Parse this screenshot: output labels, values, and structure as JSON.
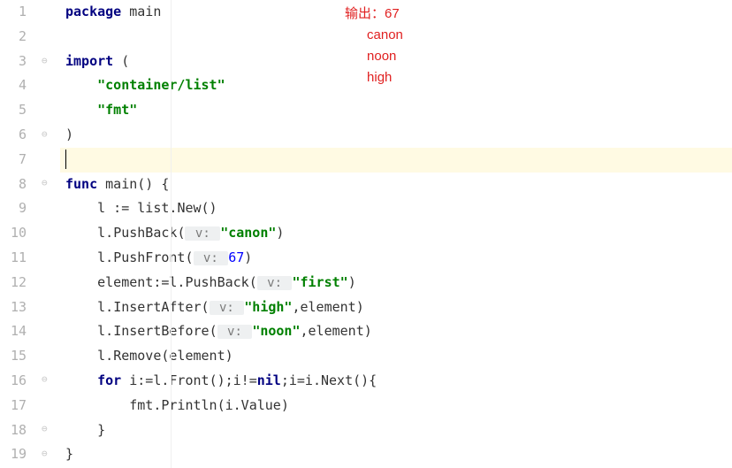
{
  "lines": [
    {
      "n": "1"
    },
    {
      "n": "2"
    },
    {
      "n": "3"
    },
    {
      "n": "4"
    },
    {
      "n": "5"
    },
    {
      "n": "6"
    },
    {
      "n": "7"
    },
    {
      "n": "8"
    },
    {
      "n": "9"
    },
    {
      "n": "10"
    },
    {
      "n": "11"
    },
    {
      "n": "12"
    },
    {
      "n": "13"
    },
    {
      "n": "14"
    },
    {
      "n": "15"
    },
    {
      "n": "16"
    },
    {
      "n": "17"
    },
    {
      "n": "18"
    },
    {
      "n": "19"
    }
  ],
  "code": {
    "l1": {
      "kw1": "package",
      "kw2": "main"
    },
    "l3": {
      "kw": "import",
      "p": " ("
    },
    "l4": {
      "indent": "    ",
      "str": "\"container/list\""
    },
    "l5": {
      "indent": "    ",
      "str": "\"fmt\""
    },
    "l6": {
      "p": ")"
    },
    "l8": {
      "kw": "func",
      "name": " main",
      "p": "() {"
    },
    "l9": {
      "indent": "    ",
      "a": "l := list.",
      "b": "New",
      "c": "()"
    },
    "l10": {
      "indent": "    ",
      "a": "l.",
      "b": "PushBack",
      "c": "(",
      "hint": " v: ",
      "str": "\"canon\"",
      "d": ")"
    },
    "l11": {
      "indent": "    ",
      "a": "l.",
      "b": "PushFront",
      "c": "(",
      "hint": " v: ",
      "num": "67",
      "d": ")"
    },
    "l12": {
      "indent": "    ",
      "a": "element:=l.",
      "b": "PushBack",
      "c": "(",
      "hint": " v: ",
      "str": "\"first\"",
      "d": ")"
    },
    "l13": {
      "indent": "    ",
      "a": "l.",
      "b": "InsertAfter",
      "c": "(",
      "hint": " v: ",
      "str": "\"high\"",
      "d": ",element)"
    },
    "l14": {
      "indent": "    ",
      "a": "l.",
      "b": "InsertBefore",
      "c": "(",
      "hint": " v: ",
      "str": "\"noon\"",
      "d": ",element)"
    },
    "l15": {
      "indent": "    ",
      "a": "l.",
      "b": "Remove",
      "c": "(element)"
    },
    "l16": {
      "indent": "    ",
      "kw": "for",
      "a": " i:=l.",
      "b": "Front",
      "c": "();i!=",
      "nil": "nil",
      "d": ";i=i.",
      "e": "Next",
      "f": "(){"
    },
    "l17": {
      "indent": "        ",
      "a": "fmt.",
      "b": "Println",
      "c": "(i.Value)"
    },
    "l18": {
      "indent": "    ",
      "p": "}"
    },
    "l19": {
      "p": "}"
    }
  },
  "marker": {
    "play": "▶"
  },
  "annotation": {
    "label": "输出：",
    "v1": "67",
    "v2": "canon",
    "v3": "noon",
    "v4": "high"
  }
}
